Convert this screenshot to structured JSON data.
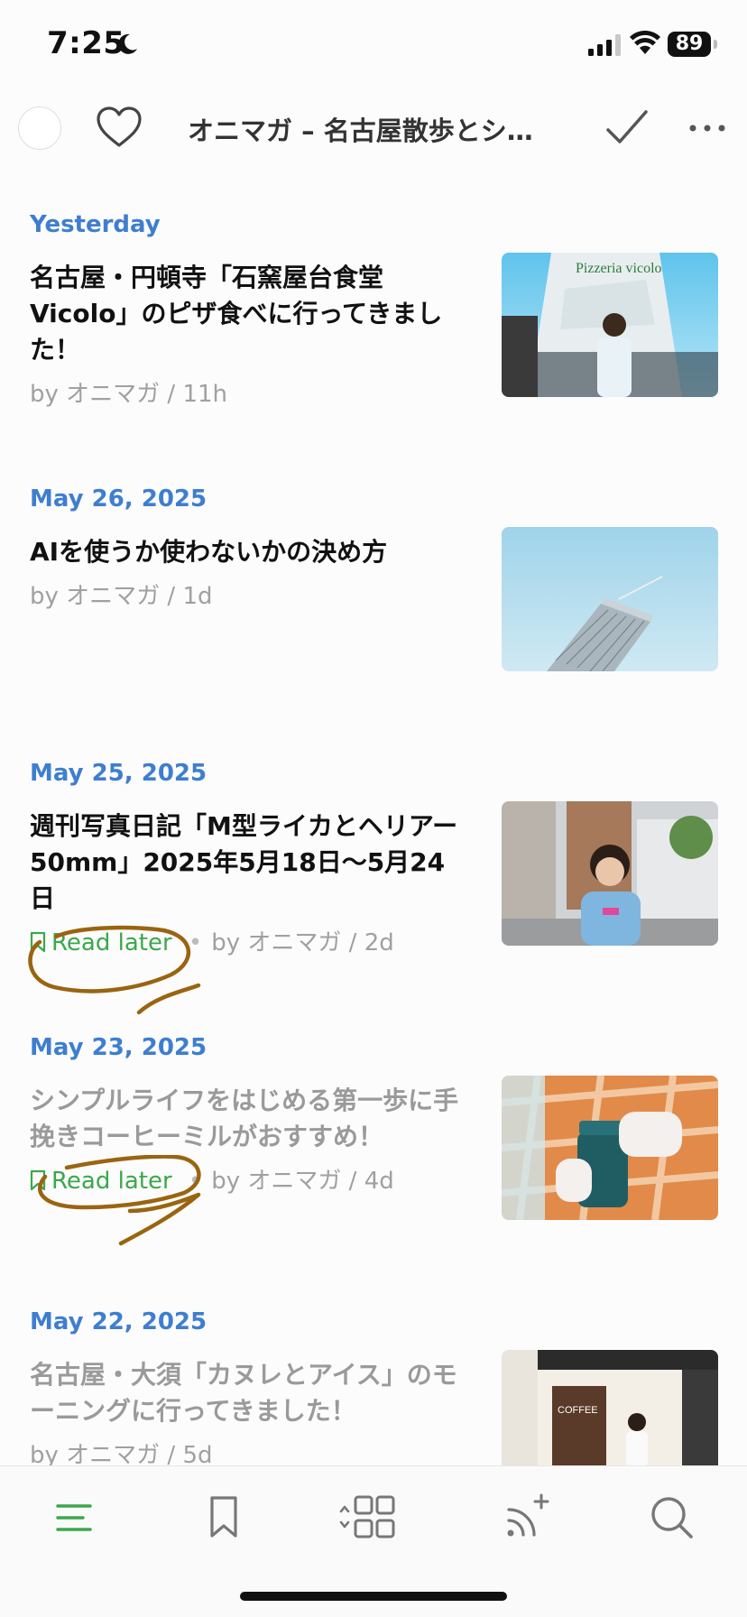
{
  "status": {
    "time": "7:25",
    "battery": "89"
  },
  "toolbar": {
    "title": "オニマガ – 名古屋散歩とシ…"
  },
  "sections": [
    {
      "date": "Yesterday",
      "article": {
        "title": "名古屋・円頓寺「石窯屋台食堂Vicolo」のピザ食べに行ってきました！",
        "meta": "by オニマガ / 11h",
        "read": false,
        "read_later": false,
        "thumb_text": "Pizzeria vicolo"
      }
    },
    {
      "date": "May 26, 2025",
      "article": {
        "title": "AIを使うか使わないかの決め方",
        "meta": "by オニマガ / 1d",
        "read": false,
        "read_later": false
      }
    },
    {
      "date": "May 25, 2025",
      "article": {
        "title": "週刊写真日記「M型ライカとヘリアー50mm」2025年5月18日〜5月24日",
        "meta": "by オニマガ / 2d",
        "read": false,
        "read_later": true
      }
    },
    {
      "date": "May 23, 2025",
      "article": {
        "title": "シンプルライフをはじめる第一歩に手挽きコーヒーミルがおすすめ！",
        "meta": "by オニマガ / 4d",
        "read": true,
        "read_later": true
      }
    },
    {
      "date": "May 22, 2025",
      "article": {
        "title": "名古屋・大須「カヌレとアイス」のモーニングに行ってきました！",
        "meta": "by オニマガ / 5d",
        "read": true,
        "read_later": false,
        "thumb_text": "COFFEE"
      }
    }
  ],
  "labels": {
    "read_later": "Read later"
  },
  "colors": {
    "date_header": "#3e7ed0",
    "read_later": "#3aa84a",
    "active_tab": "#3aa84a",
    "annotation": "#9a6410"
  },
  "tabs": [
    {
      "icon": "list-icon",
      "active": true
    },
    {
      "icon": "bookmark-icon",
      "active": false
    },
    {
      "icon": "grid-icon",
      "active": false
    },
    {
      "icon": "add-feed-icon",
      "active": false
    },
    {
      "icon": "search-icon",
      "active": false
    }
  ]
}
